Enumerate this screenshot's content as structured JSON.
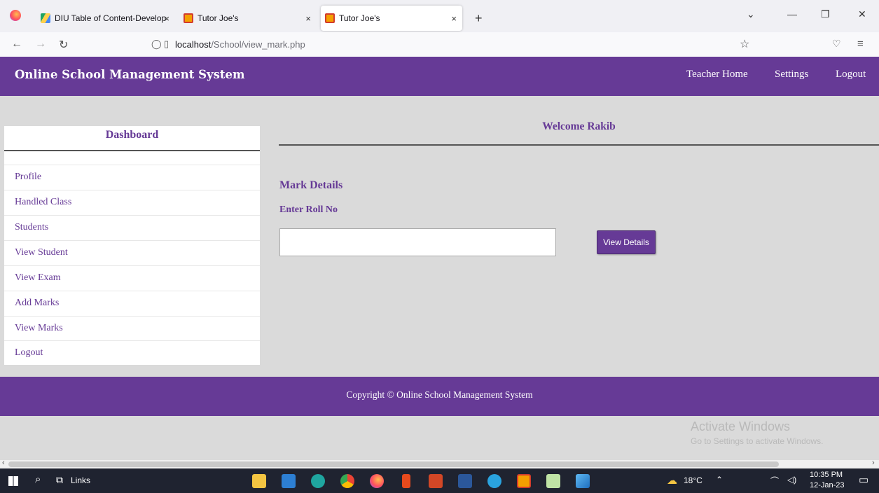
{
  "browser": {
    "tabs": [
      {
        "title": "DIU Table of Content-Developm",
        "close": "×"
      },
      {
        "title": "Tutor Joe's",
        "close": "×"
      },
      {
        "title": "Tutor Joe's",
        "close": "×"
      }
    ],
    "new_tab": "+",
    "url_host": "localhost",
    "url_path": "/School/view_mark.php",
    "icons": {
      "back": "arrow-left-icon",
      "forward": "arrow-right-icon",
      "reload": "reload-icon"
    }
  },
  "site": {
    "brand": "Online School Management System",
    "nav": [
      "Teacher Home",
      "Settings",
      "Logout"
    ]
  },
  "sidebar": {
    "title": "Dashboard",
    "items": [
      "Profile",
      "Handled Class",
      "Students",
      "View Student",
      "View Exam",
      "Add Marks",
      "View Marks",
      "Logout"
    ]
  },
  "main": {
    "welcome": "Welcome Rakib",
    "section_title": "Mark Details",
    "roll_label": "Enter Roll No",
    "roll_value": "",
    "button_label": "View Details"
  },
  "footer": {
    "text": "Copyright © Online School Management System"
  },
  "watermark": {
    "line1": "Activate Windows",
    "line2": "Go to Settings to activate Windows."
  },
  "taskbar": {
    "links_label": "Links",
    "weather": "18°C",
    "time": "10:35 PM",
    "date": "12-Jan-23"
  },
  "colors": {
    "brand_purple": "#663a96"
  }
}
